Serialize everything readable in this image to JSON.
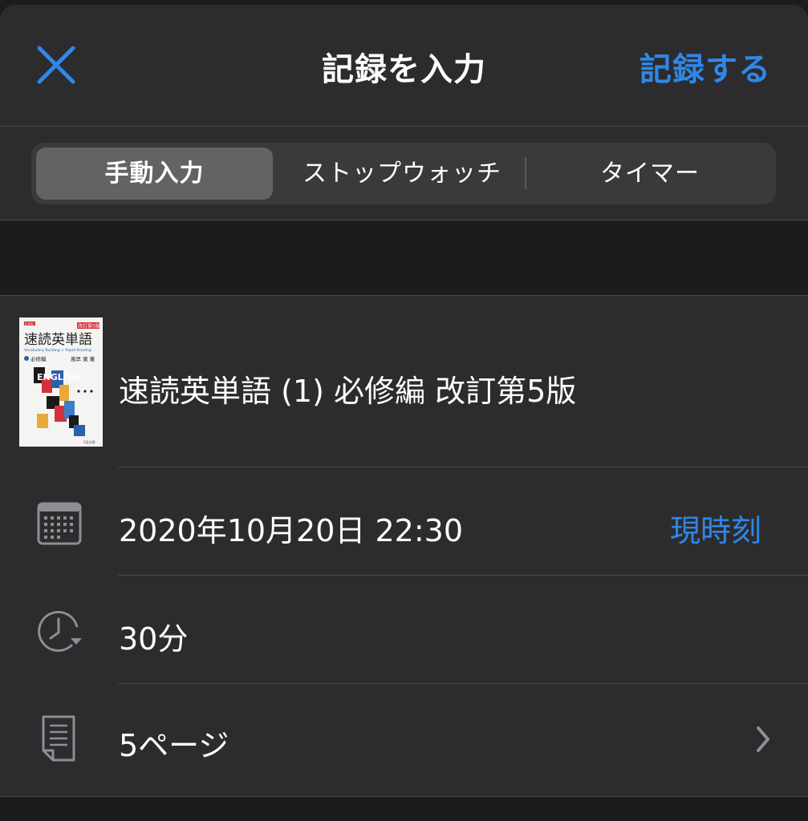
{
  "header": {
    "title": "記録を入力",
    "record_label": "記録する"
  },
  "tabs": [
    {
      "label": "手動入力",
      "active": true
    },
    {
      "label": "ストップウォッチ",
      "active": false
    },
    {
      "label": "タイマー",
      "active": false
    }
  ],
  "book": {
    "title": "速読英単語 (1) 必修編 改訂第5版",
    "cover": {
      "series_tag": "Z-KAI",
      "edition_badge": "改訂第5版",
      "title": "速読英単語",
      "subtitle": "Vocabulary Building × Rapid Reading",
      "volume": "必修編",
      "author": "風早 寛 著",
      "publisher": "Z会出版",
      "word": "ENGLISH"
    }
  },
  "datetime": {
    "value": "2020年10月20日 22:30",
    "now_label": "現時刻"
  },
  "duration": {
    "value": "30分"
  },
  "pages": {
    "value": "5ページ"
  },
  "colors": {
    "accent": "#2f87e8",
    "background": "#1c1c1e",
    "sheet": "#2c2c2e"
  },
  "icons": [
    "close-icon",
    "calendar-icon",
    "clock-icon",
    "document-icon",
    "chevron-right-icon"
  ]
}
